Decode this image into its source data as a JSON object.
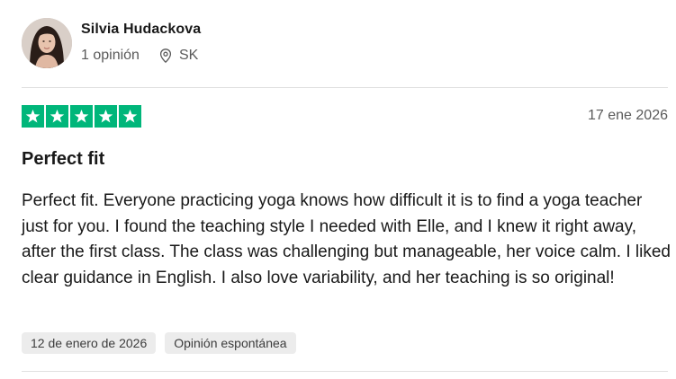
{
  "reviewer": {
    "name": "Silvia Hudackova",
    "review_count": "1 opinión",
    "country": "SK",
    "avatar_icon": "avatar-photo"
  },
  "review": {
    "rating": 5,
    "max_rating": 5,
    "star_color": "#00b67a",
    "date": "17 ene 2026",
    "title": "Perfect fit",
    "body": "Perfect fit. Everyone practicing yoga knows how difficult it is to find a yoga teacher just for you. I found the teaching style I needed with Elle, and I knew it right away, after the first class. The class was challenging but manageable, her voice calm. I liked clear guidance in English. I also love variability, and her teaching is so original!",
    "tags": [
      {
        "label": "12 de enero de 2026"
      },
      {
        "label": "Opinión espontánea"
      }
    ]
  },
  "icons": {
    "location": "map-pin-icon",
    "star": "star-icon"
  }
}
